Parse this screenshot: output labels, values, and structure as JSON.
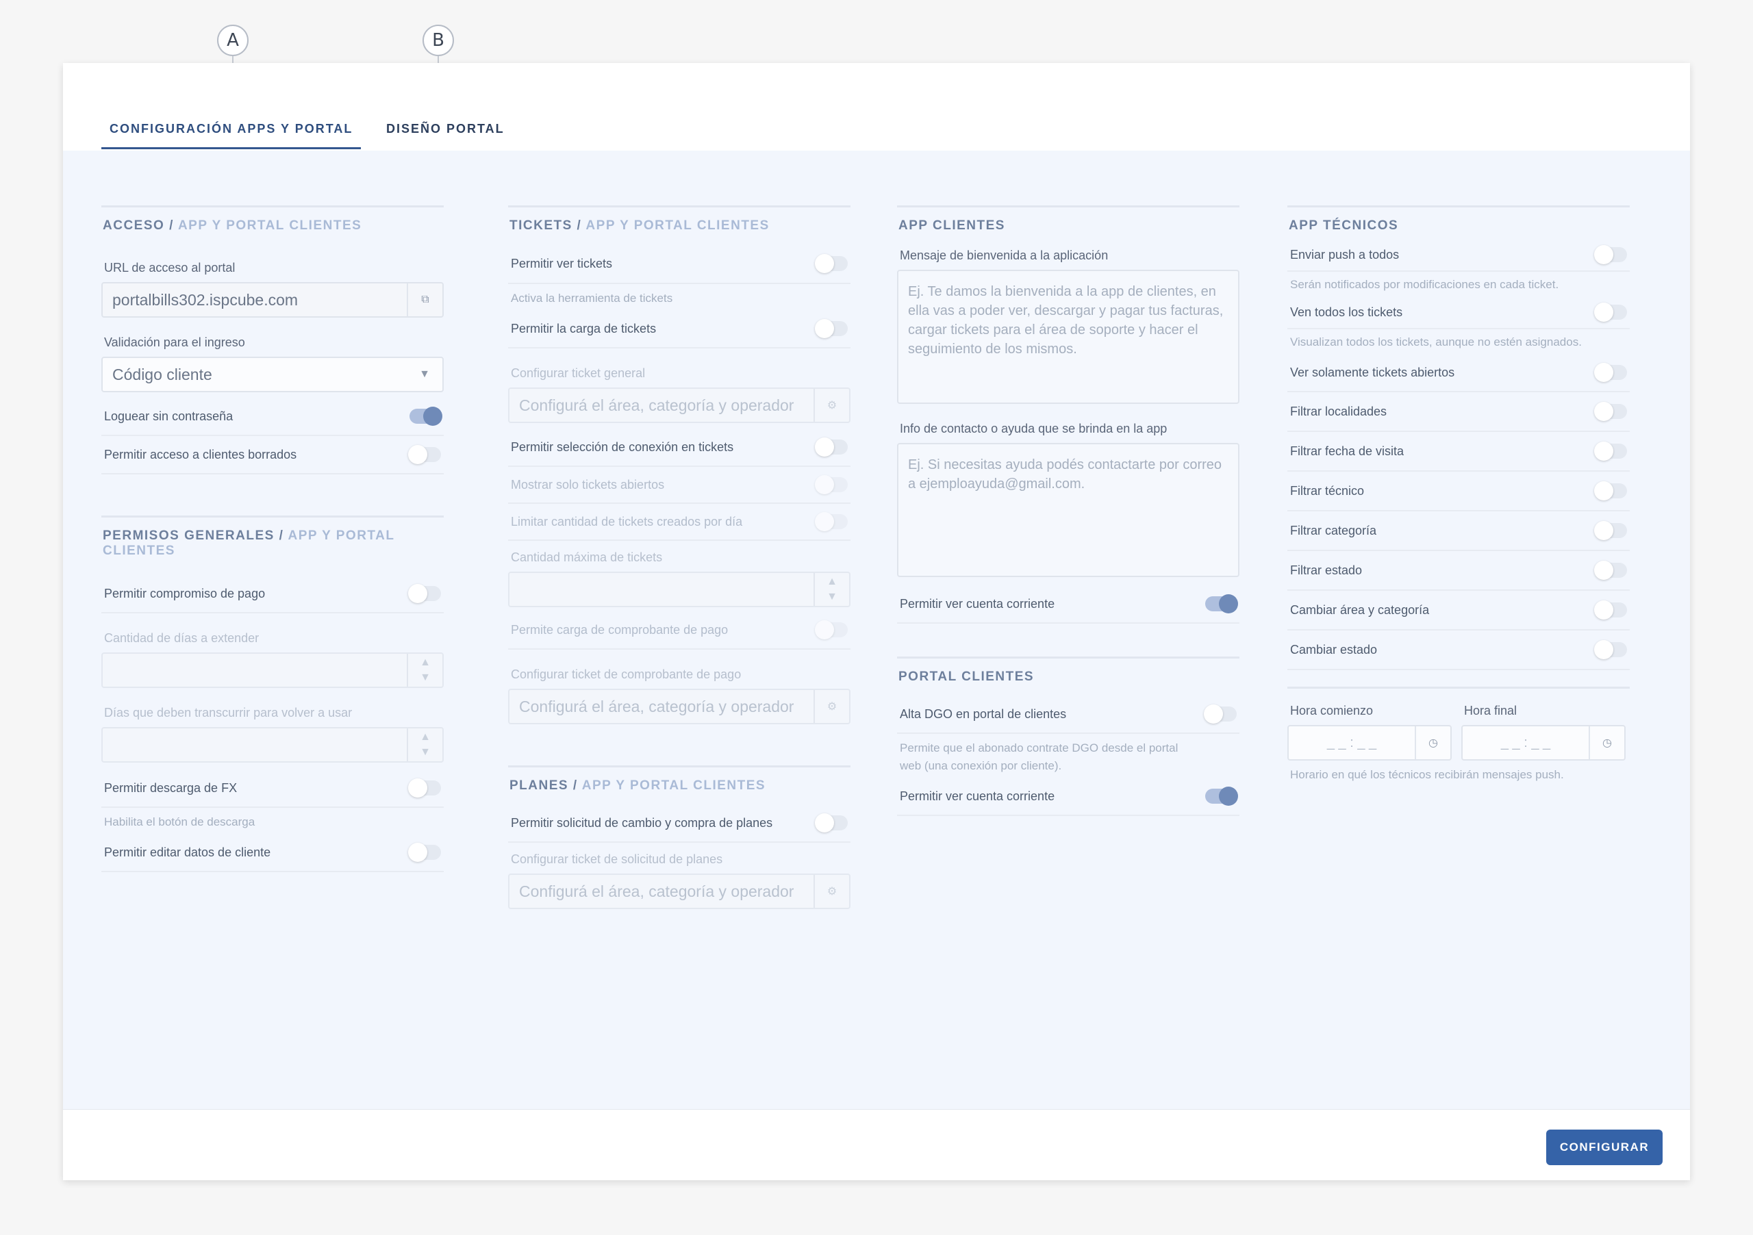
{
  "callouts": [
    "A",
    "B"
  ],
  "tabs": [
    "CONFIGURACIÓN APPS Y PORTAL",
    "DISEÑO PORTAL"
  ],
  "footer": {
    "configure_label": "CONFIGURAR"
  },
  "colors": {
    "accent": "#3563a8",
    "toggle_on": "#6f8ab8",
    "content_bg": "#f2f6fd"
  },
  "acceso": {
    "title": "ACCESO",
    "title_sub": "APP Y PORTAL CLIENTES",
    "url_label": "URL de acceso al portal",
    "url_value": "portalbills302.ispcube.com",
    "validation_label": "Validación para el ingreso",
    "validation_value": "Código cliente",
    "toggles": [
      {
        "label": "Loguear sin contraseña",
        "on": true
      },
      {
        "label": "Permitir acceso a clientes borrados",
        "on": false
      }
    ]
  },
  "permisos": {
    "title": "PERMISOS GENERALES",
    "title_sub": "APP Y PORTAL CLIENTES",
    "compromiso_label": "Permitir compromiso de pago",
    "dias_extender_label": "Cantidad de días a extender",
    "dias_volver_label": "Días que deben transcurrir para volver a usar",
    "descarga_label": "Permitir descarga de FX",
    "descarga_hint": "Habilita el botón de descarga",
    "editar_label": "Permitir editar datos de cliente"
  },
  "tickets": {
    "title": "TICKETS",
    "title_sub": "APP Y PORTAL CLIENTES",
    "ver_label": "Permitir ver tickets",
    "ver_hint": "Activa la herramienta de tickets",
    "carga_label": "Permitir la carga de tickets",
    "config_general_label": "Configurar ticket general",
    "config_placeholder": "Configurá el área, categoría y operador",
    "seleccion_label": "Permitir selección de conexión en tickets",
    "solo_abiertos_label": "Mostrar solo tickets abiertos",
    "limitar_label": "Limitar cantidad de tickets creados por día",
    "cantidad_max_label": "Cantidad máxima de tickets",
    "comprobante_label": "Permite carga de comprobante de pago",
    "config_comprobante_label": "Configurar ticket de comprobante de pago"
  },
  "planes": {
    "title": "PLANES",
    "title_sub": "APP Y PORTAL CLIENTES",
    "solicitud_label": "Permitir solicitud de cambio y compra de planes",
    "config_label": "Configurar ticket de solicitud de planes",
    "config_placeholder": "Configurá el área, categoría y operador"
  },
  "app_clientes": {
    "title": "APP CLIENTES",
    "bienvenida_label": "Mensaje de bienvenida a la aplicación",
    "bienvenida_placeholder": "Ej. Te damos la bienvenida a la app de clientes, en ella vas a poder ver, descargar y pagar tus facturas, cargar tickets para el área de soporte y hacer el seguimiento de los mismos.",
    "contacto_label": "Info de contacto o ayuda que se brinda en la app",
    "contacto_placeholder": "Ej. Si necesitas ayuda podés contactarte por correo a ejemploayuda@gmail.com.",
    "cuenta_label": "Permitir ver cuenta corriente"
  },
  "portal_clientes": {
    "title": "PORTAL CLIENTES",
    "dgo_label": "Alta DGO en portal de clientes",
    "dgo_hint": "Permite que el abonado contrate DGO desde el portal web (una conexión por cliente).",
    "cuenta_label": "Permitir ver cuenta corriente"
  },
  "app_tecnicos": {
    "title": "APP TÉCNICOS",
    "push_label": "Enviar push a todos",
    "push_hint": "Serán notificados por modificaciones en cada ticket.",
    "todos_label": "Ven todos los tickets",
    "todos_hint": "Visualizan todos los tickets, aunque no estén asignados.",
    "filters": [
      "Ver solamente tickets abiertos",
      "Filtrar localidades",
      "Filtrar fecha de visita",
      "Filtrar técnico",
      "Filtrar categoría",
      "Filtrar estado",
      "Cambiar área y categoría",
      "Cambiar estado"
    ],
    "hora_comienzo_label": "Hora comienzo",
    "hora_final_label": "Hora final",
    "time_placeholder": "_ _ : _ _",
    "horario_hint": "Horario en qué los técnicos recibirán mensajes push."
  }
}
